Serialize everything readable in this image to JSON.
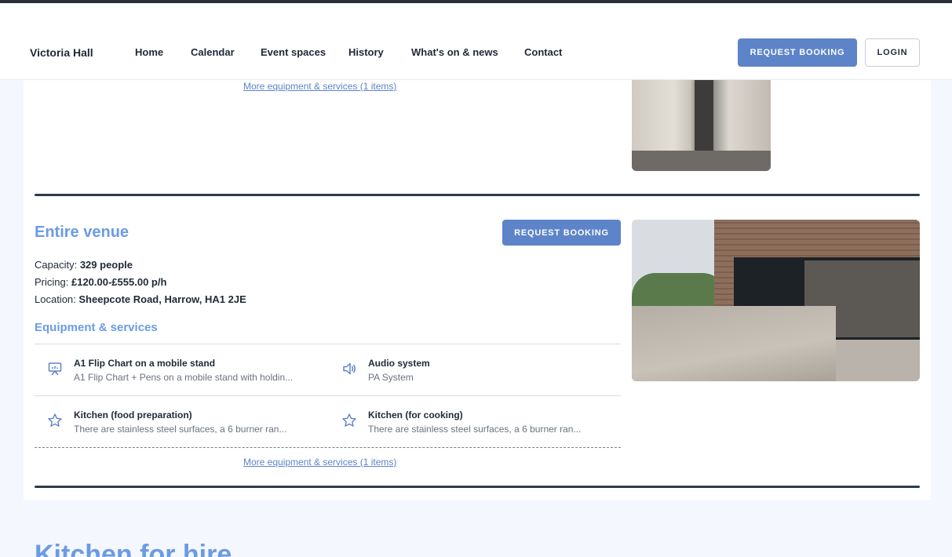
{
  "header": {
    "brand": "Victoria Hall",
    "nav": [
      "Home",
      "Calendar",
      "Event spaces",
      "History",
      "What's on & news",
      "Contact"
    ],
    "request_booking": "REQUEST BOOKING",
    "login": "LOGIN"
  },
  "previous_space": {
    "more_link": "More equipment & services (1 items)"
  },
  "space": {
    "title": "Entire venue",
    "request_booking": "REQUEST BOOKING",
    "capacity_label": "Capacity:",
    "capacity_value": "329 people",
    "pricing_label": "Pricing:",
    "pricing_value": "£120.00-£555.00 p/h",
    "location_label": "Location:",
    "location_value": "Sheepcote Road, Harrow, HA1 2JE",
    "equipment_title": "Equipment & services",
    "equipment": [
      {
        "icon": "presentation-board-icon",
        "name": "A1 Flip Chart on a mobile stand",
        "desc": "A1 Flip Chart + Pens on a mobile stand with holdin..."
      },
      {
        "icon": "speaker-icon",
        "name": "Audio system",
        "desc": "PA System"
      },
      {
        "icon": "star-icon",
        "name": "Kitchen (food preparation)",
        "desc": "There are stainless steel surfaces, a 6 burner ran..."
      },
      {
        "icon": "star-icon",
        "name": "Kitchen (for cooking)",
        "desc": "There are stainless steel surfaces, a 6 burner ran..."
      }
    ],
    "more_link": "More equipment & services (1 items)"
  },
  "next_section": {
    "title": "Kitchen for hire"
  },
  "colors": {
    "accent": "#5d84c8",
    "heading": "#6b9be4",
    "divider": "#2f3b4c",
    "page_bg": "#f4f7fd"
  }
}
